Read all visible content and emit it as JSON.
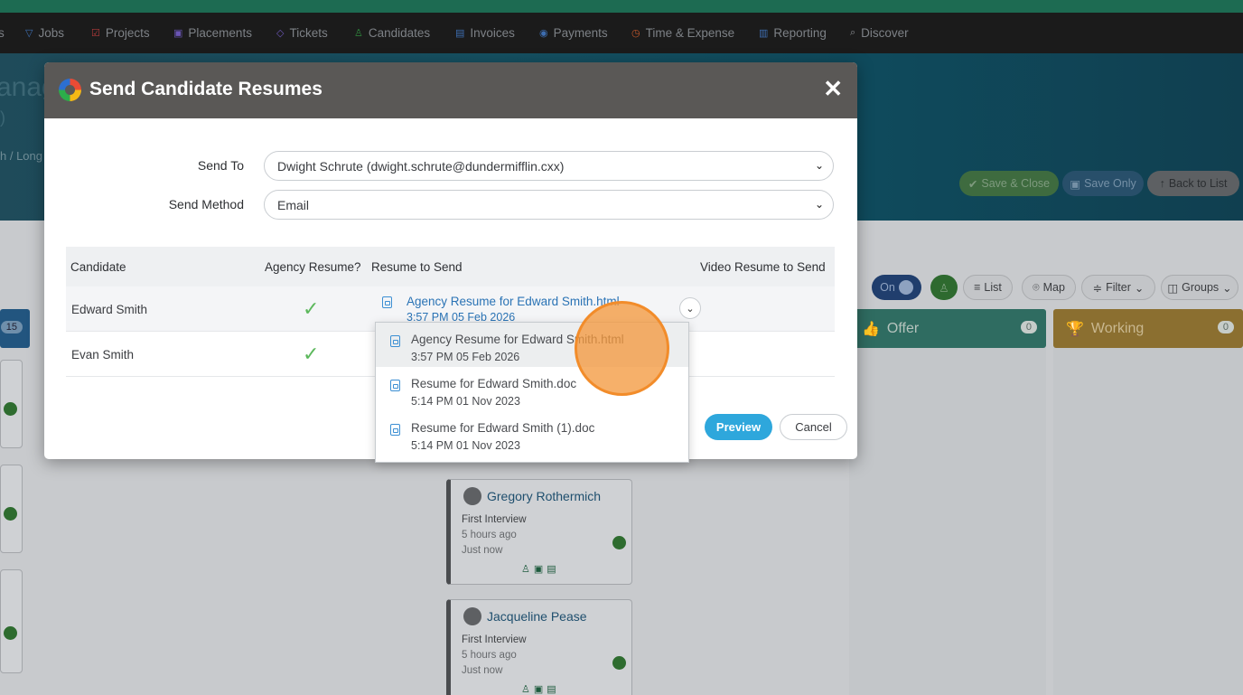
{
  "nav": {
    "items": [
      {
        "label": "s",
        "icon": "partial-icon"
      },
      {
        "label": "Jobs",
        "icon": "funnel-icon"
      },
      {
        "label": "Projects",
        "icon": "checkbox-icon"
      },
      {
        "label": "Placements",
        "icon": "briefcase-icon"
      },
      {
        "label": "Tickets",
        "icon": "tag-icon"
      },
      {
        "label": "Candidates",
        "icon": "users-icon"
      },
      {
        "label": "Invoices",
        "icon": "document-icon"
      },
      {
        "label": "Payments",
        "icon": "coins-icon"
      },
      {
        "label": "Time & Expense",
        "icon": "clock-icon"
      },
      {
        "label": "Reporting",
        "icon": "bar-chart-icon"
      },
      {
        "label": "Discover",
        "icon": "search-icon"
      }
    ]
  },
  "hero": {
    "title_fragment": "anag",
    "sub_fragment": ")",
    "breadcrumb_fragment": "h / Long",
    "save_close": "Save & Close",
    "save_only": "Save Only",
    "back_to_list": "Back to List"
  },
  "toolbar": {
    "on_prefix": "n",
    "on_label": "On",
    "list_label": "List",
    "map_label": "Map",
    "filter_label": "Filter",
    "groups_label": "Groups"
  },
  "board": {
    "first_count": "15",
    "offer_label": "Offer",
    "offer_count": "0",
    "working_label": "Working",
    "working_count": "0",
    "cards": [
      {
        "name": "Gregory Rothermich",
        "stage": "First Interview",
        "time": "5 hours ago",
        "now": "Just now"
      },
      {
        "name": "Jacqueline Pease",
        "stage": "First Interview",
        "time": "5 hours ago",
        "now": "Just now"
      }
    ]
  },
  "modal": {
    "title": "Send Candidate Resumes",
    "send_to_label": "Send To",
    "send_to_value": "Dwight Schrute (dwight.schrute@dundermifflin.cxx)",
    "send_method_label": "Send Method",
    "send_method_value": "Email",
    "table": {
      "headers": [
        "Candidate",
        "Agency Resume?",
        "Resume to Send",
        "Video Resume to Send"
      ],
      "rows": [
        {
          "candidate": "Edward Smith",
          "agency": true,
          "resume_name": "Agency Resume for Edward Smith.html",
          "resume_date": "3:57 PM 05 Feb 2026"
        },
        {
          "candidate": "Evan Smith",
          "agency": true,
          "resume_name": "",
          "resume_date": ""
        }
      ]
    },
    "dropdown": [
      {
        "name": "Agency Resume for Edward Smith.html",
        "date": "3:57 PM 05 Feb 2026"
      },
      {
        "name": "Resume for Edward Smith.doc",
        "date": "5:14 PM 01 Nov 2023"
      },
      {
        "name": "Resume for Edward Smith (1).doc",
        "date": "5:14 PM 01 Nov 2023"
      }
    ],
    "preview_label": "Preview",
    "cancel_label": "Cancel"
  },
  "colors": {
    "accent": "#2ea7dc",
    "check": "#5cb85c",
    "link": "#2a73b5",
    "header": "#5a5856"
  }
}
